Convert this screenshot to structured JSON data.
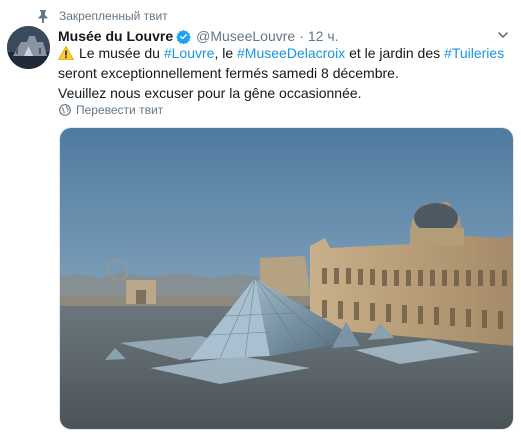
{
  "pinned": {
    "label": "Закрепленный твит",
    "icon": "pin-icon"
  },
  "author": {
    "display_name": "Musée du Louvre",
    "verified_icon": "verified-badge-icon",
    "handle": "@MuseeLouvre",
    "separator": "·",
    "time": "12 ч."
  },
  "tweet": {
    "warning_icon": "warning-icon",
    "segments": {
      "s1": "Le musée du ",
      "tag1": "#Louvre",
      "s2": ", le ",
      "tag2": "#MuseeDelacroix",
      "s3": " et le jardin des ",
      "tag3": "#Tuileries",
      "s4": " seront exceptionnellement fermés samedi 8 décembre."
    },
    "line2": "Veuillez nous excuser pour la gêne occasionnée."
  },
  "translate": {
    "label": "Перевести твит",
    "icon": "globe-icon"
  },
  "colors": {
    "link": "#1b95e0",
    "muted": "#657786",
    "verified": "#1da1f2",
    "text": "#14171a"
  }
}
